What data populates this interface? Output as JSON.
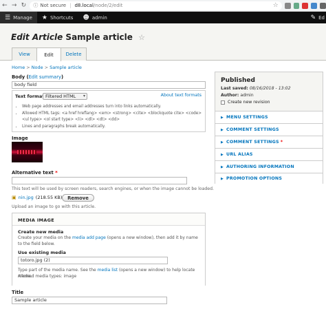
{
  "browser": {
    "security": "Not secure",
    "host": "d8.local",
    "path": "/node/2/edit"
  },
  "toolbar": {
    "manage": "Manage",
    "shortcuts": "Shortcuts",
    "user": "admin",
    "edit": "Ed"
  },
  "header": {
    "title_italic": "Edit Article",
    "title_plain": "Sample article",
    "tabs": [
      "View",
      "Edit",
      "Delete"
    ]
  },
  "breadcrumb": [
    "Home",
    "Node",
    "Sample article"
  ],
  "body_field": {
    "label": "Body",
    "summary_link": "Edit summary",
    "value": "body field",
    "text_format_label": "Text format",
    "text_format_value": "Filtered HTML",
    "about_link": "About text formats",
    "tips": [
      "Web page addresses and email addresses turn into links automatically.",
      "Allowed HTML tags: <a href hreflang> <em> <strong> <cite> <blockquote cite> <code> <ul type> <ol start type> <li> <dl> <dt> <dd>",
      "Lines and paragraphs break automatically."
    ]
  },
  "image_field": {
    "label": "Image",
    "alt_label": "Alternative text",
    "alt_required": "*",
    "alt_value": "",
    "alt_desc": "This text will be used by screen readers, search engines, or when the image cannot be loaded.",
    "file_name": "nin.jpg",
    "file_size": "(218.55 KB)",
    "remove_label": "Remove",
    "upload_desc": "Upload an image to go with this article."
  },
  "media_image": {
    "title": "MEDIA IMAGE",
    "create_heading": "Create new media",
    "create_text_pre": "Create your media on the ",
    "create_link": "media add page",
    "create_text_post": " (opens a new window), then add it by name to the field below.",
    "use_heading": "Use existing media",
    "use_value": "totoro.jpg (2)",
    "type_text_pre": "Type part of the media name. See the ",
    "type_link": "media list",
    "type_text_post": " (opens a new window) to help locate media.",
    "allowed_types": "Allowed media types: image"
  },
  "title_field": {
    "label": "Title",
    "value": "Sample article"
  },
  "sidebar": {
    "status": "Published",
    "last_saved_label": "Last saved:",
    "last_saved_value": "08/16/2018 - 13:02",
    "author_label": "Author:",
    "author_value": "admin",
    "new_revision": "Create new revision",
    "sections": [
      {
        "label": "MENU SETTINGS"
      },
      {
        "label": "COMMENT SETTINGS"
      },
      {
        "label": "COMMENT SETTINGS"
      },
      {
        "label": "URL ALIAS"
      },
      {
        "label": "AUTHORING INFORMATION"
      },
      {
        "label": "PROMOTION OPTIONS"
      }
    ],
    "required_marker": "*"
  }
}
